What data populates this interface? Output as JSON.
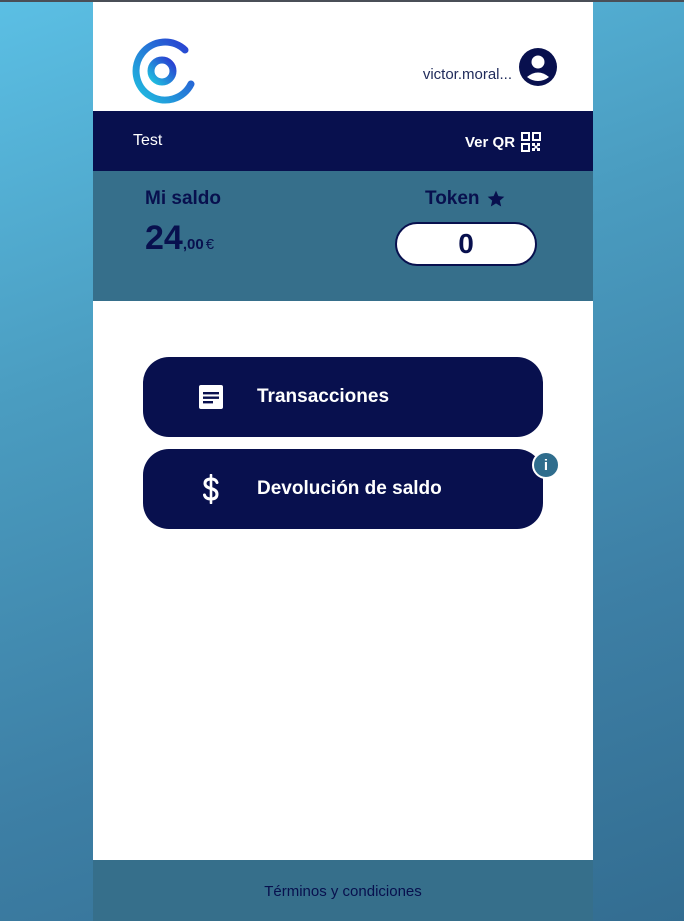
{
  "header": {
    "user_name": "victor.moral...",
    "logo_icon": "logo-g-icon",
    "avatar_icon": "account-circle-icon"
  },
  "navbar": {
    "title": "Test",
    "qr_label": "Ver QR",
    "qr_icon": "qr-code-icon"
  },
  "balance": {
    "label": "Mi saldo",
    "integer": "24",
    "decimals": ",00",
    "currency": "€"
  },
  "token": {
    "label": "Token",
    "icon": "star-icon",
    "value": "0"
  },
  "actions": [
    {
      "label": "Transacciones",
      "icon": "receipt-icon"
    },
    {
      "label": "Devolución de saldo",
      "icon": "dollar-icon",
      "badge": "i"
    }
  ],
  "footer": {
    "link": "Términos y condiciones"
  },
  "colors": {
    "primary": "#08104e",
    "band": "#366f8b",
    "badge": "#2f6d8d"
  }
}
